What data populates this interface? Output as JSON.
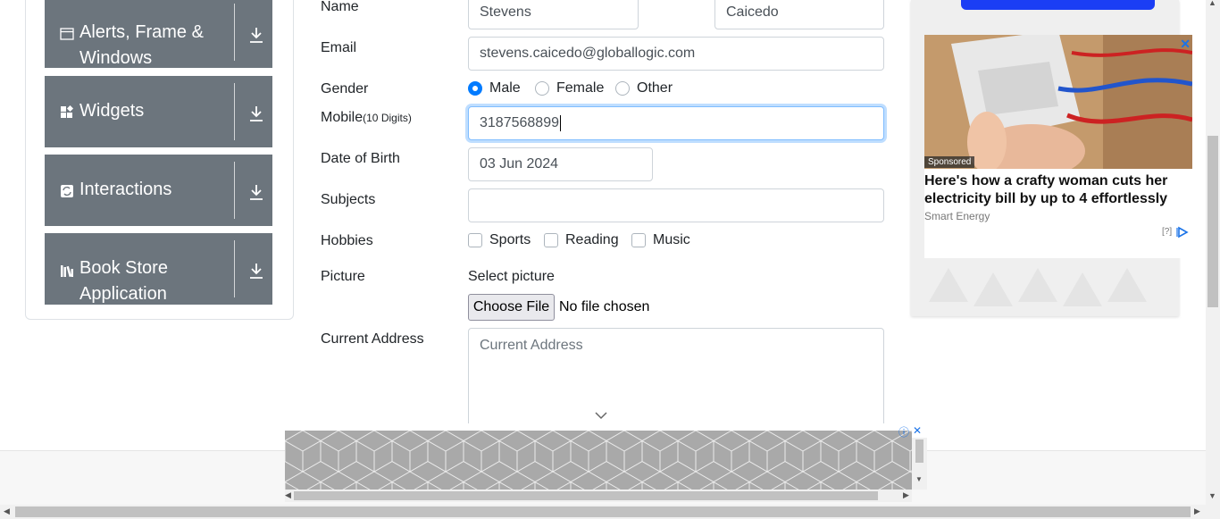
{
  "sidebar": {
    "groups": [
      {
        "title_line1": "Alerts, Frame &",
        "title_line2": "Windows",
        "icon": "window-icon"
      },
      {
        "title_line1": "Widgets",
        "icon": "widgets-icon"
      },
      {
        "title_line1": "Interactions",
        "icon": "interactions-icon"
      },
      {
        "title_line1": "Book Store",
        "title_line2": "Application",
        "icon": "books-icon"
      }
    ]
  },
  "form": {
    "name_label": "Name",
    "first_name": "Stevens",
    "last_name": "Caicedo",
    "email_label": "Email",
    "email": "stevens.caicedo@globallogic.com",
    "gender_label": "Gender",
    "gender_options": [
      "Male",
      "Female",
      "Other"
    ],
    "gender_selected": "Male",
    "mobile_label": "Mobile",
    "mobile_hint": "(10 Digits)",
    "mobile": "3187568899",
    "dob_label": "Date of Birth",
    "dob": "03 Jun 2024",
    "subjects_label": "Subjects",
    "hobbies_label": "Hobbies",
    "hobbies": [
      "Sports",
      "Reading",
      "Music"
    ],
    "picture_label": "Picture",
    "select_picture": "Select picture",
    "choose_file": "Choose File",
    "no_file": "No file chosen",
    "address_label": "Current Address",
    "address_placeholder": "Current Address"
  },
  "ad_right": {
    "sponsored": "Sponsored",
    "headline": "Here's how a crafty woman cuts her electricity bill by up to 4 effortlessly",
    "source": "Smart Energy",
    "question": "[?]",
    "close": "✕"
  },
  "ad_bottom": {
    "info": "ⓘ",
    "close": "✕"
  },
  "colors": {
    "accent": "#007bff",
    "sidebar_group": "#6c757d",
    "ad_button": "#1b3ef5"
  }
}
